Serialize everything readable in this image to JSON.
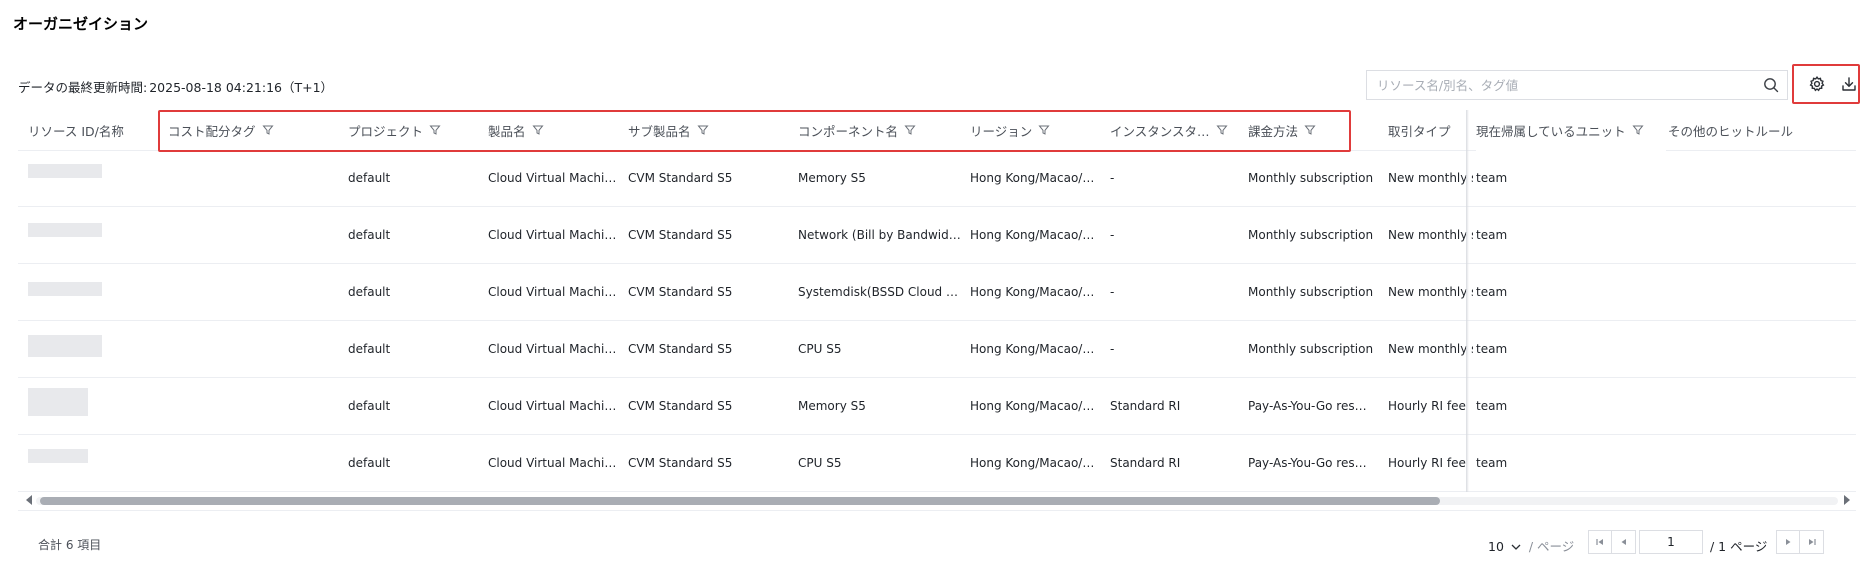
{
  "page_title": "オーガニゼイション",
  "update": {
    "label": "データの最終更新時間:",
    "timestamp": "2025-08-18 04:21:16（T+1）"
  },
  "search": {
    "placeholder": "リソース名/別名、タグ値"
  },
  "toolbar": {
    "settings_icon": "gear-icon",
    "download_icon": "download-icon"
  },
  "table": {
    "columns": [
      {
        "label": "リソース ID/名称",
        "filter": false
      },
      {
        "label": "コスト配分タグ",
        "filter": true
      },
      {
        "label": "プロジェクト",
        "filter": true
      },
      {
        "label": "製品名",
        "filter": true
      },
      {
        "label": "サブ製品名",
        "filter": true
      },
      {
        "label": "コンポーネント名",
        "filter": true
      },
      {
        "label": "リージョン",
        "filter": true
      },
      {
        "label": "インスタンスタ…",
        "filter": true
      },
      {
        "label": "課金方法",
        "filter": true
      },
      {
        "label": "取引タイプ",
        "filter": false
      },
      {
        "label": "現在帰属しているユニット",
        "filter": true
      },
      {
        "label": "その他のヒットルール",
        "filter": false
      }
    ],
    "rows": [
      {
        "id": "",
        "tag": "",
        "project": "default",
        "product": "Cloud Virtual Machi…",
        "subproduct": "CVM Standard S5",
        "component": "Memory S5",
        "region": "Hong Kong/Macao/…",
        "instance": "-",
        "billing": "Monthly subscription",
        "transaction": "New monthly s",
        "unit": "team",
        "other": ""
      },
      {
        "id": "",
        "tag": "",
        "project": "default",
        "product": "Cloud Virtual Machi…",
        "subproduct": "CVM Standard S5",
        "component": "Network (Bill by Bandwidth)",
        "region": "Hong Kong/Macao/…",
        "instance": "-",
        "billing": "Monthly subscription",
        "transaction": "New monthly s",
        "unit": "team",
        "other": ""
      },
      {
        "id": "",
        "tag": "",
        "project": "default",
        "product": "Cloud Virtual Machi…",
        "subproduct": "CVM Standard S5",
        "component": "Systemdisk(BSSD Cloud …",
        "region": "Hong Kong/Macao/…",
        "instance": "-",
        "billing": "Monthly subscription",
        "transaction": "New monthly s",
        "unit": "team",
        "other": ""
      },
      {
        "id": "",
        "tag": "",
        "project": "default",
        "product": "Cloud Virtual Machi…",
        "subproduct": "CVM Standard S5",
        "component": "CPU S5",
        "region": "Hong Kong/Macao/…",
        "instance": "-",
        "billing": "Monthly subscription",
        "transaction": "New monthly s",
        "unit": "team",
        "other": ""
      },
      {
        "id": "",
        "tag": "",
        "project": "default",
        "product": "Cloud Virtual Machi…",
        "subproduct": "CVM Standard S5",
        "component": "Memory S5",
        "region": "Hong Kong/Macao/…",
        "instance": "Standard RI",
        "billing": "Pay-As-You-Go res…",
        "transaction": "Hourly RI fee",
        "unit": "team",
        "other": ""
      },
      {
        "id": "",
        "tag": "",
        "project": "default",
        "product": "Cloud Virtual Machi…",
        "subproduct": "CVM Standard S5",
        "component": "CPU S5",
        "region": "Hong Kong/Macao/…",
        "instance": "Standard RI",
        "billing": "Pay-As-You-Go res…",
        "transaction": "Hourly RI fee",
        "unit": "team",
        "other": ""
      }
    ]
  },
  "footer": {
    "total": "合計 6 項目",
    "page_size": "10",
    "page_size_unit": "/ ページ",
    "current_page": "1",
    "total_pages": "/ 1 ページ"
  },
  "colors": {
    "highlight": "#e03b3b",
    "border": "#eceef2",
    "scroll_thumb": "#a9adb4"
  }
}
